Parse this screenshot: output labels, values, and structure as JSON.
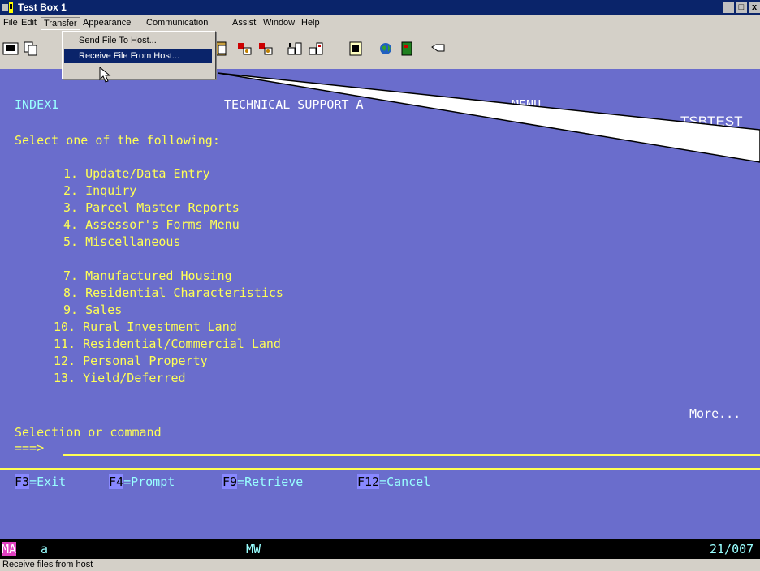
{
  "window": {
    "title": "Test Box 1",
    "controls": [
      "_",
      "̅",
      "x"
    ]
  },
  "menubar": [
    "File",
    "Edit",
    "Transfer",
    "Appearance",
    "Communication",
    "Assist",
    "Window",
    "Help"
  ],
  "transfer_menu": {
    "items": [
      "Send File To Host...",
      "Receive File From Host..."
    ]
  },
  "toolbar": {
    "icons": [
      "print-screen-icon",
      "copy-icon",
      "paste-icon",
      "record-macro-icon",
      "play-macro-icon",
      "send-file-icon",
      "receive-file-icon",
      "clipboard-icon",
      "globe-icon",
      "book-icon",
      "hand-icon"
    ]
  },
  "terminal": {
    "program": "INDEX1",
    "header_visible": "TECHNICAL SUPPORT A",
    "header_tail": "MENU",
    "system": "TSBTEST",
    "prompt": "Select one of the following:",
    "options": [
      "1. Update/Data Entry",
      "2. Inquiry",
      "3. Parcel Master Reports",
      "4. Assessor's Forms Menu",
      "5. Miscellaneous",
      "7. Manufactured Housing",
      "8. Residential Characteristics",
      "9. Sales",
      "10. Rural Investment Land",
      "11. Residential/Commercial Land",
      "12. Personal Property",
      "13. Yield/Deferred"
    ],
    "more": "More...",
    "command_label": "Selection or command",
    "command_arrow": "===>",
    "fkeys": [
      {
        "key": "F3",
        "label": "=Exit"
      },
      {
        "key": "F4",
        "label": "=Prompt"
      },
      {
        "key": "F9",
        "label": "=Retrieve"
      },
      {
        "key": "F12",
        "label": "=Cancel"
      }
    ]
  },
  "oia": {
    "mode": "MA",
    "field": "a",
    "mw": "MW",
    "position": "21/007"
  },
  "statusbar": {
    "text": "Receive files from host"
  }
}
